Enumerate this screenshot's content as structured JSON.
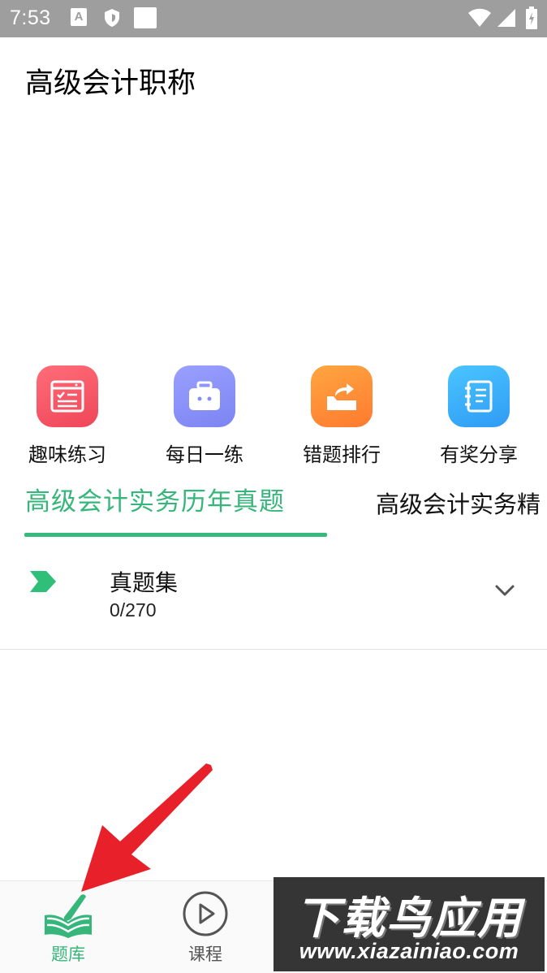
{
  "status_bar": {
    "time": "7:53",
    "a_badge": "A",
    "icons": [
      "a-badge-icon",
      "shield-icon",
      "square-icon",
      "wifi-icon",
      "signal-icon",
      "battery-icon"
    ]
  },
  "header": {
    "title": "高级会计职称"
  },
  "quick_actions": [
    {
      "label": "趣味练习",
      "icon": "checklist-icon",
      "color": "#f3505f"
    },
    {
      "label": "每日一练",
      "icon": "briefcase-icon",
      "color": "#868df8"
    },
    {
      "label": "错题排行",
      "icon": "share-box-icon",
      "color": "#ff8a36"
    },
    {
      "label": "有奖分享",
      "icon": "notebook-icon",
      "color": "#3aaef8"
    }
  ],
  "tabs": [
    {
      "label": "高级会计实务历年真题",
      "active": true
    },
    {
      "label": "高级会计实务精",
      "active": false
    }
  ],
  "list": {
    "items": [
      {
        "title": "真题集",
        "progress": "0/270"
      }
    ]
  },
  "bottom_nav": [
    {
      "label": "题库",
      "icon": "book-pen-icon",
      "active": true
    },
    {
      "label": "课程",
      "icon": "play-circle-icon",
      "active": false
    }
  ],
  "watermark": {
    "main": "下载鸟应用",
    "url": "www.xiazainiao.com"
  },
  "colors": {
    "accent": "#36b67a",
    "status_bar": "#9e9e9e",
    "arrow": "#e8202a"
  }
}
